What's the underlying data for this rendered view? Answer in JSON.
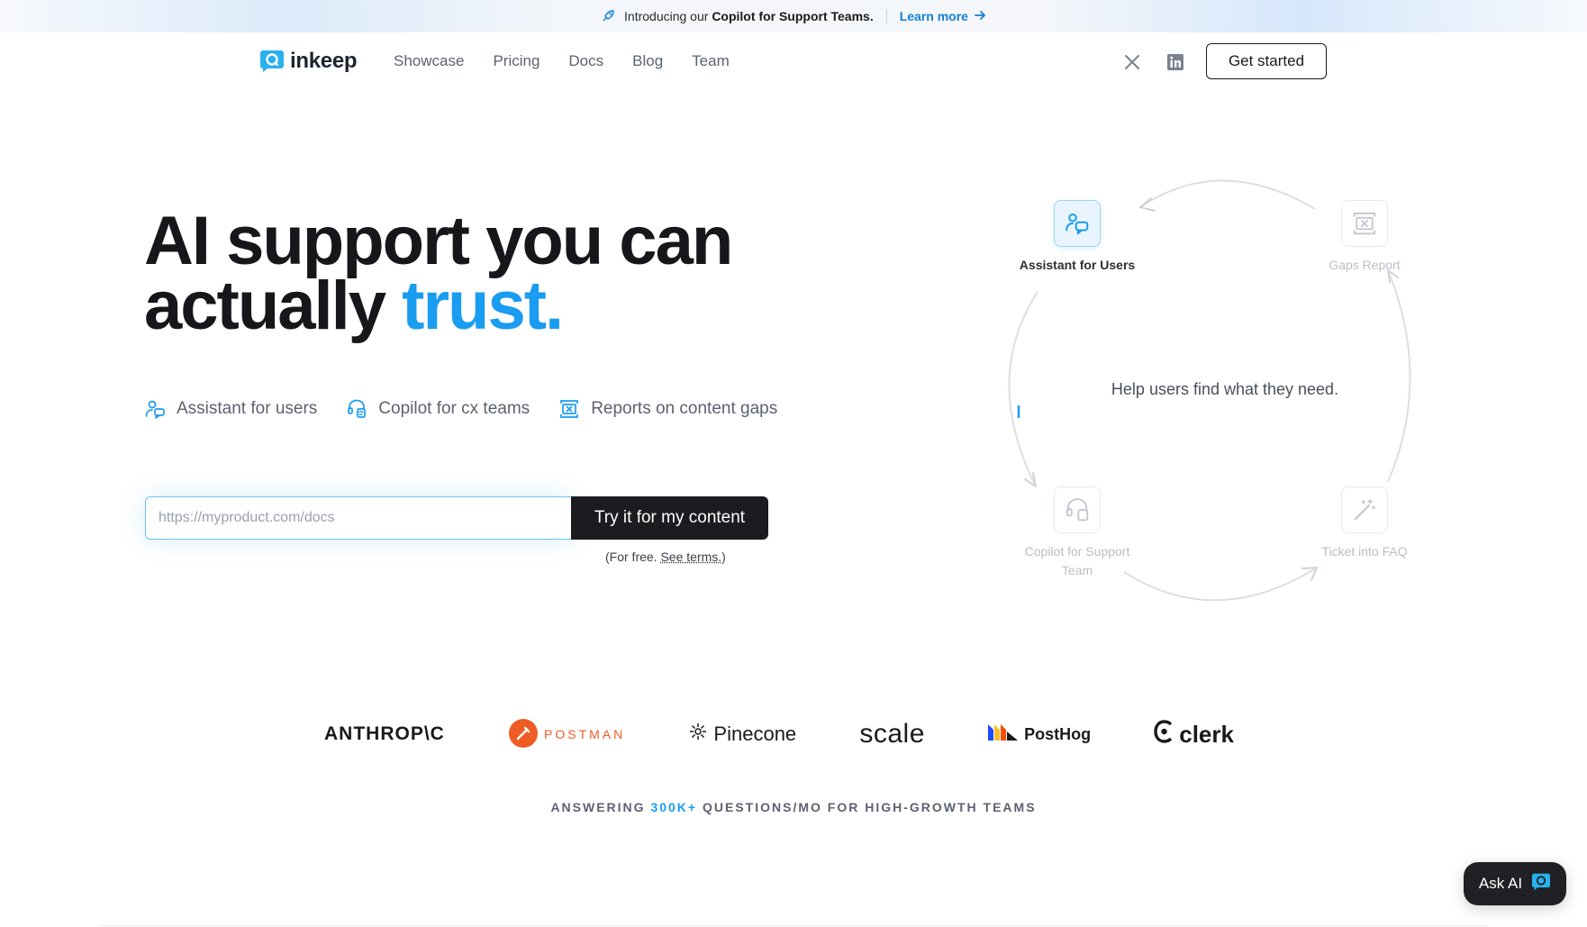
{
  "announcement": {
    "prefix": "Introducing our",
    "highlight": "Copilot for Support Teams.",
    "link": "Learn more",
    "icon": "rocket-icon"
  },
  "nav": {
    "brand": "inkeep",
    "links": [
      "Showcase",
      "Pricing",
      "Docs",
      "Blog",
      "Team"
    ],
    "social_icons": [
      "x-icon",
      "linkedin-icon"
    ],
    "cta": "Get started"
  },
  "hero": {
    "title_line1": "AI support you can",
    "title_line2_prefix": "actually",
    "title_accent": "trust.",
    "accent_color": "#1a9cf0",
    "features": [
      {
        "label": "Assistant for users",
        "icon": "user-chat-icon"
      },
      {
        "label": "Copilot for cx teams",
        "icon": "headset-icon"
      },
      {
        "label": "Reports on content gaps",
        "icon": "gap-report-icon"
      }
    ],
    "input_placeholder": "https://myproduct.com/docs",
    "cta_button": "Try it for my content",
    "note_prefix": "(For free.",
    "note_link": "See terms.",
    "note_suffix": ")"
  },
  "cycle": {
    "center_text": "Help users find what they need.",
    "nodes": [
      {
        "label": "Assistant for Users",
        "icon": "user-chat-icon",
        "active": true
      },
      {
        "label": "Gaps Report",
        "icon": "gap-report-icon",
        "active": false
      },
      {
        "label": "Copilot for Support Team",
        "icon": "headset-icon",
        "active": false
      },
      {
        "label": "Ticket into FAQ",
        "icon": "magic-wand-icon",
        "active": false
      }
    ]
  },
  "logos": [
    "ANTHROP\\C",
    "POSTMAN",
    "Pinecone",
    "scale",
    "PostHog",
    "clerk"
  ],
  "answering": {
    "prefix": "ANSWERING",
    "highlight": "300K+",
    "suffix": "QUESTIONS/MO FOR HIGH-GROWTH TEAMS"
  },
  "ask_ai": {
    "label": "Ask AI",
    "icon": "chat-icon"
  }
}
